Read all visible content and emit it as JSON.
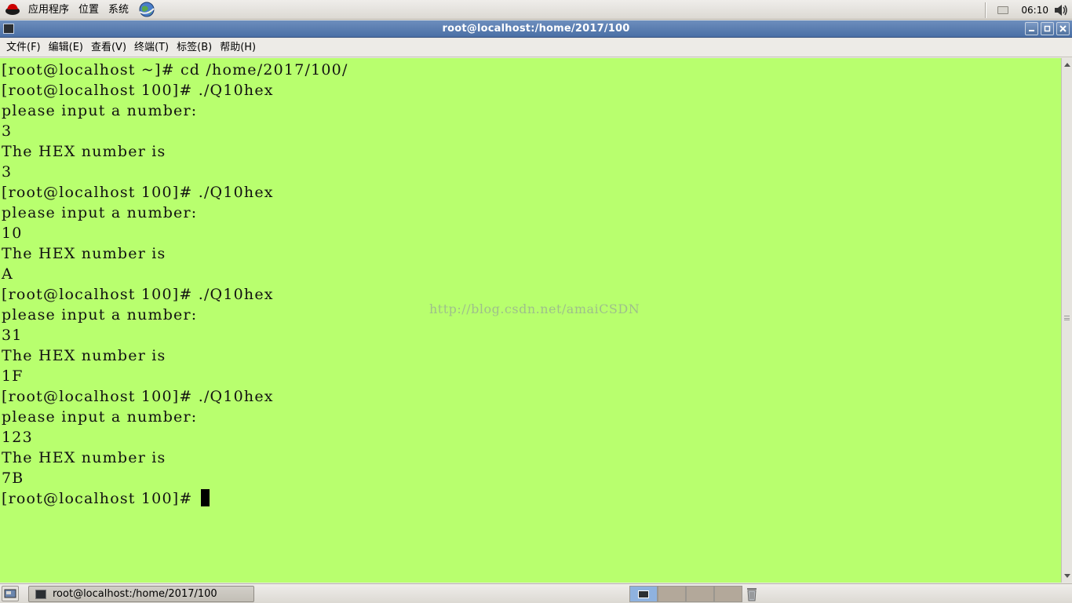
{
  "top_panel": {
    "menus": [
      "应用程序",
      "位置",
      "系统"
    ],
    "clock": "06:10",
    "icons": [
      "redhat-logo-icon",
      "network-globe-icon",
      "tray-icon",
      "volume-icon"
    ]
  },
  "window": {
    "title": "root@localhost:/home/2017/100",
    "buttons": [
      "minimize",
      "maximize",
      "close"
    ]
  },
  "menubar": {
    "items": [
      "文件(F)",
      "编辑(E)",
      "查看(V)",
      "终端(T)",
      "标签(B)",
      "帮助(H)"
    ]
  },
  "terminal": {
    "background": "#b8ff6e",
    "lines": [
      "[root@localhost ~]# cd /home/2017/100/",
      "[root@localhost 100]# ./Q10hex",
      "please input a number:",
      "3",
      "The HEX number is",
      "3",
      "[root@localhost 100]# ./Q10hex",
      "please input a number:",
      "10",
      "The HEX number is",
      "A",
      "[root@localhost 100]# ./Q10hex",
      "please input a number:",
      "31",
      "The HEX number is",
      "1F",
      "[root@localhost 100]# ./Q10hex",
      "please input a number:",
      "123",
      "The HEX number is",
      "7B",
      "[root@localhost 100]# "
    ],
    "watermark": "http://blog.csdn.net/amaiCSDN"
  },
  "bottom_panel": {
    "task_label": "root@localhost:/home/2017/100",
    "workspace_count": 4,
    "active_workspace": 1
  }
}
